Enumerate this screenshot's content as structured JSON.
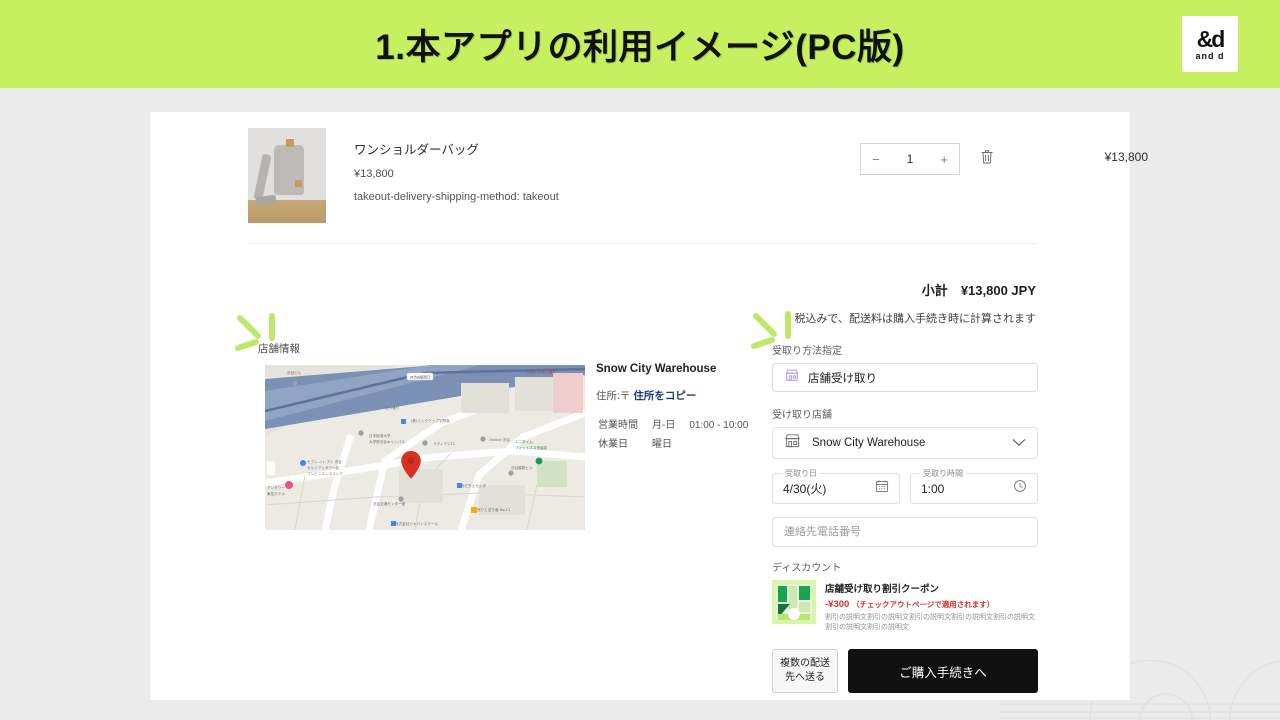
{
  "slide": {
    "title": "1.本アプリの利用イメージ(PC版)",
    "header_color": "#c6f060",
    "logo_mark": "&d",
    "logo_sub": "and d"
  },
  "cart": {
    "item": {
      "title": "ワンショルダーバッグ",
      "price": "¥13,800",
      "variant": "takeout-delivery-shipping-method: takeout",
      "image_alt": "ワンショルダーバッグ",
      "quantity": "1",
      "decrement_label": "−",
      "increment_label": "+",
      "remove_icon": "trash-icon",
      "line_total": "¥13,800"
    },
    "subtotal_label": "小計",
    "subtotal_value": "¥13,800 JPY",
    "tax_note": "税込みで、配送料は購入手続き時に計算されます"
  },
  "store_info": {
    "section_label": "店舗情報",
    "name": "Snow City Warehouse",
    "address_label": "住所:〒",
    "address_copy_link": "住所をコピー",
    "hours_label": "営業時間",
    "hours_days": "月-日",
    "hours_time": "01:00 - 10:00",
    "closed_label": "休業日",
    "closed_value": "曜日",
    "map_marker": "map-pin-icon"
  },
  "pickup": {
    "method_label": "受取り方法指定",
    "method_value": "店舗受け取り",
    "method_icon": "store-icon",
    "store_label": "受け取り店舗",
    "store_value": "Snow City Warehouse",
    "store_icon": "storefront-icon",
    "chevron_icon": "chevron-down-icon",
    "date_label": "受取り日",
    "date_value": "4/30(火)",
    "date_icon": "calendar-icon",
    "time_label": "受取り時間",
    "time_value": "1:00",
    "time_icon": "clock-icon",
    "phone_placeholder": "連絡先電話番号",
    "phone_value": ""
  },
  "discount": {
    "label": "ディスカウント",
    "coupon_title": "店舗受け取り割引クーポン",
    "coupon_amount": "-¥300",
    "coupon_note": "（チェックアウトページで適用されます）",
    "coupon_desc": "割引の説明文割引の説明文割引の説明文割引の説明文割引の説明文割引の説明文割引の説明文",
    "amount_color": "#d0312d"
  },
  "actions": {
    "multi_ship_label": "複数の配送先へ送る",
    "checkout_label": "ご購入手続きへ"
  }
}
